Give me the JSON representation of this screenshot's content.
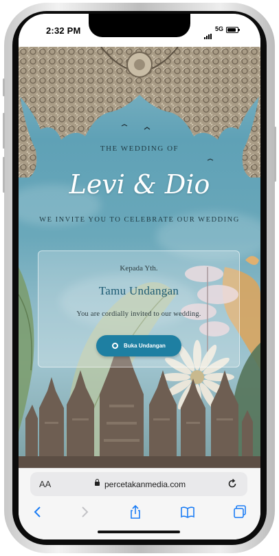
{
  "status_bar": {
    "time": "2:32 PM",
    "network": "5G"
  },
  "invitation": {
    "heading": "THE WEDDING OF",
    "couple_names": "Levi & Dio",
    "tagline": "WE INVITE YOU TO CELEBRATE OUR WEDDING",
    "card": {
      "salutation": "Kepada Yth.",
      "guest_name": "Tamu Undangan",
      "message": "You are cordially invited to our wedding.",
      "open_button_label": "Buka Undangan"
    }
  },
  "browser": {
    "text_size_label": "AA",
    "url": "percetakanmedia.com",
    "toolbar": [
      "back-icon",
      "forward-icon",
      "share-icon",
      "bookmarks-icon",
      "tabs-icon"
    ]
  },
  "colors": {
    "accent": "#1e7fa2",
    "sky": "#6aa8ba",
    "heading_text": "#1f3a44"
  }
}
